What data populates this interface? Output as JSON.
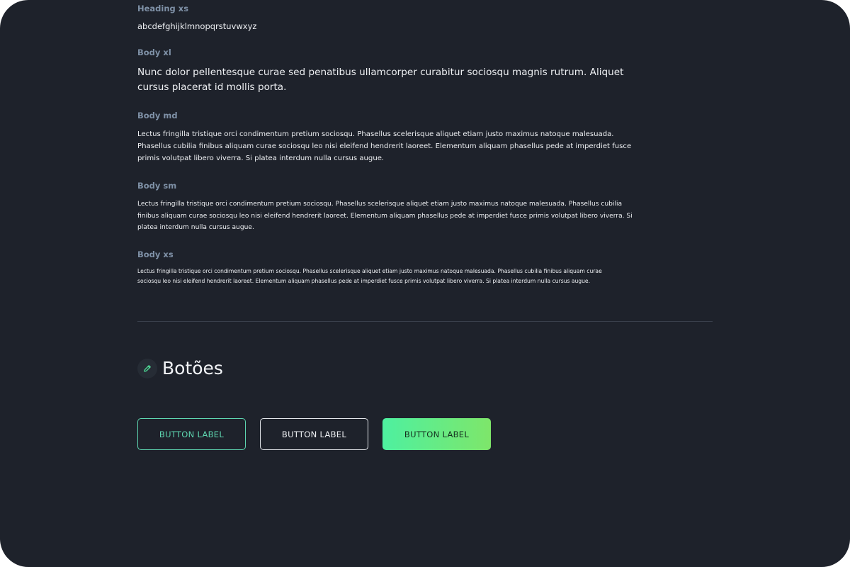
{
  "typography": {
    "heading_xs": {
      "label": "Heading xs",
      "sample": "abcdefghijklmnopqrstuvwxyz"
    },
    "body_xl": {
      "label": "Body xl",
      "sample": "Nunc dolor pellentesque curae sed penatibus ullamcorper curabitur sociosqu magnis rutrum. Aliquet cursus placerat id mollis porta."
    },
    "body_md": {
      "label": "Body md",
      "sample": "Lectus fringilla tristique orci condimentum pretium sociosqu. Phasellus scelerisque aliquet etiam justo maximus natoque malesuada. Phasellus cubilia finibus aliquam curae sociosqu leo nisi eleifend hendrerit laoreet. Elementum aliquam phasellus pede at imperdiet fusce primis volutpat libero viverra. Si platea interdum nulla cursus augue."
    },
    "body_sm": {
      "label": "Body sm",
      "sample": "Lectus fringilla tristique orci condimentum pretium sociosqu. Phasellus scelerisque aliquet etiam justo maximus natoque malesuada. Phasellus cubilia finibus aliquam curae sociosqu leo nisi eleifend hendrerit laoreet. Elementum aliquam phasellus pede at imperdiet fusce primis volutpat libero viverra. Si platea interdum nulla cursus augue."
    },
    "body_xs": {
      "label": "Body xs",
      "sample": "Lectus fringilla tristique orci condimentum pretium sociosqu. Phasellus scelerisque aliquet etiam justo maximus natoque malesuada. Phasellus cubilia finibus aliquam curae sociosqu leo nisi eleifend hendrerit laoreet. Elementum aliquam phasellus pede at imperdiet fusce primis volutpat libero viverra. Si platea interdum nulla cursus augue."
    }
  },
  "buttons_section": {
    "title": "Botões",
    "icon": "pencil-icon",
    "buttons": [
      {
        "variant": "outline-accent",
        "label": "BUTTON LABEL"
      },
      {
        "variant": "outline-light",
        "label": "BUTTON LABEL"
      },
      {
        "variant": "gradient",
        "label": "BUTTON LABEL"
      }
    ]
  },
  "colors": {
    "background": "#1e222b",
    "label_muted": "#7f91a7",
    "text_primary": "#eef0f3",
    "accent": "#5ed6b0",
    "gradient_start": "#4ef0a0",
    "gradient_end": "#7ee66a",
    "divider": "#3a404c"
  }
}
